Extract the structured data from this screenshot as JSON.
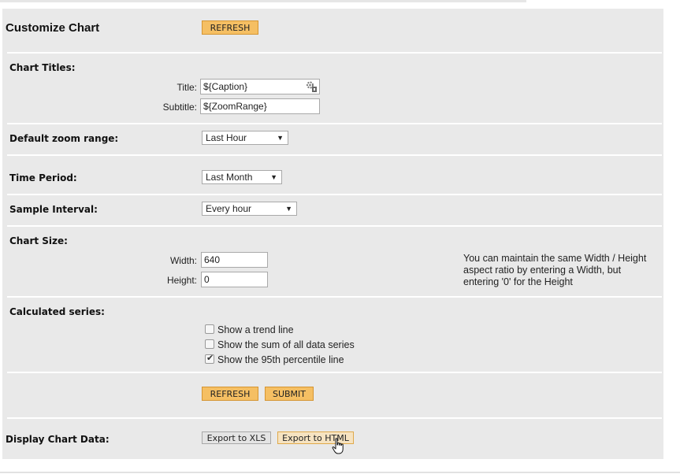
{
  "header": {
    "title": "Customize Chart",
    "refresh_label": "REFRESH"
  },
  "chart_titles": {
    "heading": "Chart Titles:",
    "title_label": "Title:",
    "title_value": "${Caption}",
    "subtitle_label": "Subtitle:",
    "subtitle_value": "${ZoomRange}"
  },
  "zoom": {
    "heading": "Default zoom range:",
    "selected": "Last Hour"
  },
  "time_period": {
    "heading": "Time Period:",
    "selected": "Last Month"
  },
  "sample_interval": {
    "heading": "Sample Interval:",
    "selected": "Every hour"
  },
  "chart_size": {
    "heading": "Chart Size:",
    "width_label": "Width:",
    "width_value": "640",
    "height_label": "Height:",
    "height_value": "0",
    "note_line1": "You can maintain the same Width / Height",
    "note_line2": "aspect ratio by entering a Width, but",
    "note_line3": "entering '0' for the Height"
  },
  "calculated_series": {
    "heading": "Calculated series:",
    "options": [
      {
        "label": "Show a trend line",
        "checked": false
      },
      {
        "label": "Show the sum of all data series",
        "checked": false
      },
      {
        "label": "Show the 95th percentile line",
        "checked": true
      }
    ]
  },
  "actions": {
    "refresh_label": "REFRESH",
    "submit_label": "SUBMIT"
  },
  "display_data": {
    "heading": "Display Chart Data:",
    "export_xls_label": "Export to XLS",
    "export_html_label": "Export to HTML"
  },
  "icons": {
    "title_field_icon": "insert-variable-icon",
    "cursor": "hand-pointer-icon"
  },
  "colors": {
    "panel": "#e9e9e9",
    "button_orange": "#f5bf63",
    "button_border": "#d59532"
  }
}
